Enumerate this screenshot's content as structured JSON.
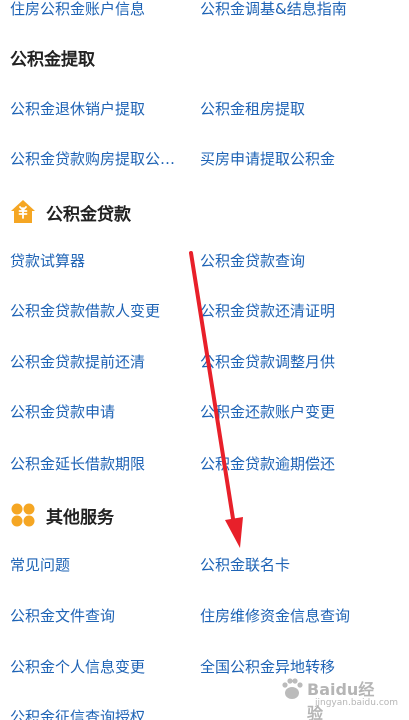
{
  "top_row": {
    "left": "住房公积金账户信息",
    "right": "公积金调基&结息指南"
  },
  "withdrawal": {
    "title": "公积金提取",
    "items": [
      "公积金退休销户提取",
      "公积金租房提取",
      "公积金贷款购房提取公…",
      "买房申请提取公积金"
    ]
  },
  "loan": {
    "title": "公积金贷款",
    "icon": "house-loan-icon",
    "icon_color": "#f5a623",
    "items": [
      "贷款试算器",
      "公积金贷款查询",
      "公积金贷款借款人变更",
      "公积金贷款还清证明",
      "公积金贷款提前还清",
      "公积金贷款调整月供",
      "公积金贷款申请",
      "公积金还款账户变更",
      "公积金延长借款期限",
      "公积金贷款逾期偿还"
    ]
  },
  "other": {
    "title": "其他服务",
    "icon": "four-dots-icon",
    "icon_color": "#f5a623",
    "items": [
      "常见问题",
      "公积金联名卡",
      "公积金文件查询",
      "住房维修资金信息查询",
      "公积金个人信息变更",
      "全国公积金异地转移",
      "公积金征信查询授权"
    ]
  },
  "watermark": {
    "brand": "Baidu经验",
    "sub": "jingyan.baidu.com"
  },
  "colors": {
    "link": "#1e63b5",
    "heading": "#222222",
    "arrow": "#e8202a"
  }
}
